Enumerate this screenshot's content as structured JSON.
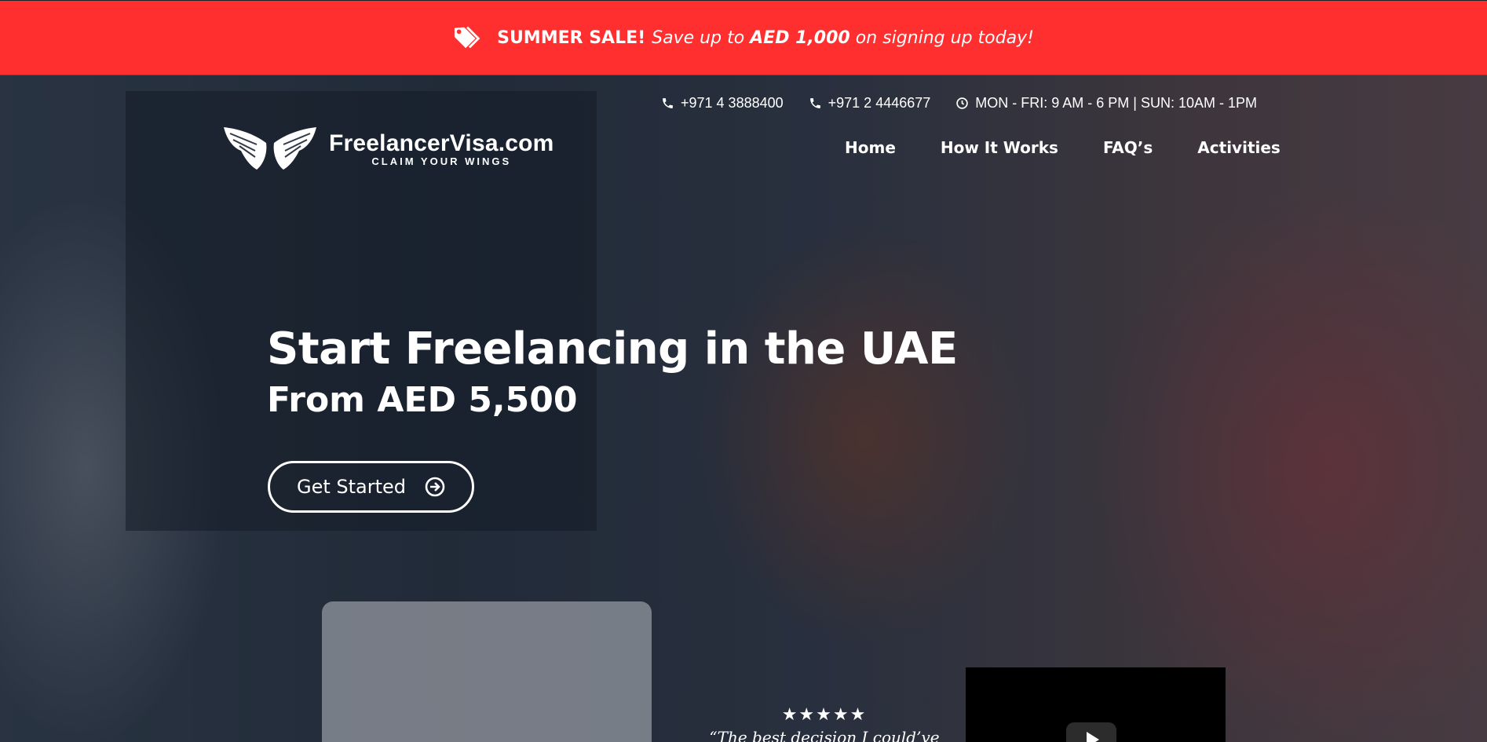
{
  "promo": {
    "icon": "tags-icon",
    "strong": "SUMMER SALE!",
    "text_before": "Save up to",
    "amount": "AED 1,000",
    "text_after": "on signing up today!",
    "background": "#ff2f2f"
  },
  "contacts": {
    "phone1": "+971 4 3888400",
    "phone2": "+971 2 4446677",
    "hours": "MON - FRI: 9 AM - 6 PM | SUN: 10AM - 1PM"
  },
  "logo": {
    "brand": "FreelancerVisa.com",
    "slogan": "CLAIM YOUR WINGS"
  },
  "nav": {
    "items": [
      "Home",
      "How It Works",
      "FAQ’s",
      "Activities"
    ]
  },
  "hero": {
    "headline": "Start Freelancing in the UAE",
    "subheadline": "From AED 5,500",
    "cta_label": "Get Started"
  },
  "review": {
    "stars": "★★★★★",
    "quote": "“The best decision I could’ve"
  }
}
